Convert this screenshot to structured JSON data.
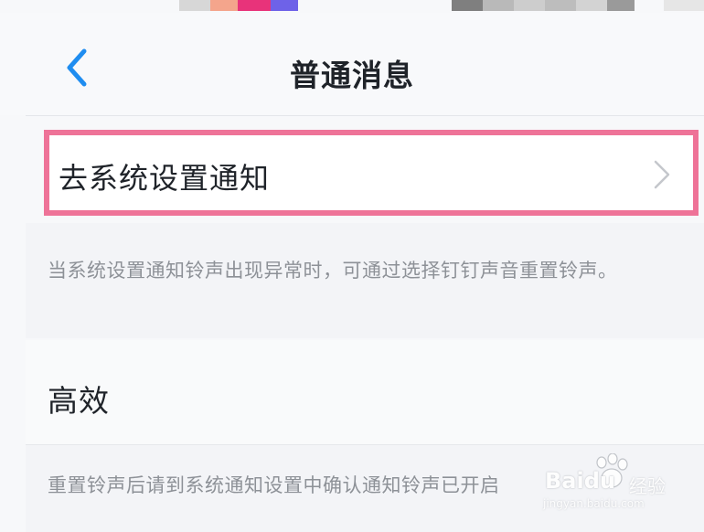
{
  "header": {
    "title": "普通消息",
    "back_icon": "chevron-left-icon",
    "accent_color": "#1f8df0"
  },
  "system_notification_row": {
    "label": "去系统设置通知",
    "chevron_icon": "chevron-right-icon",
    "highlight_color": "#ee7398"
  },
  "tip_1": {
    "text": "当系统设置通知铃声出现异常时，可通过选择钉钉声音重置铃声。"
  },
  "section": {
    "title": "高效"
  },
  "tip_2": {
    "text": "重置铃声后请到系统通知设置中确认通知铃声已开启"
  },
  "watermark": {
    "brand": "Bai",
    "brand_suffix": "du",
    "brand_cn": "经验",
    "url": "jingyan.baidu.com"
  }
}
